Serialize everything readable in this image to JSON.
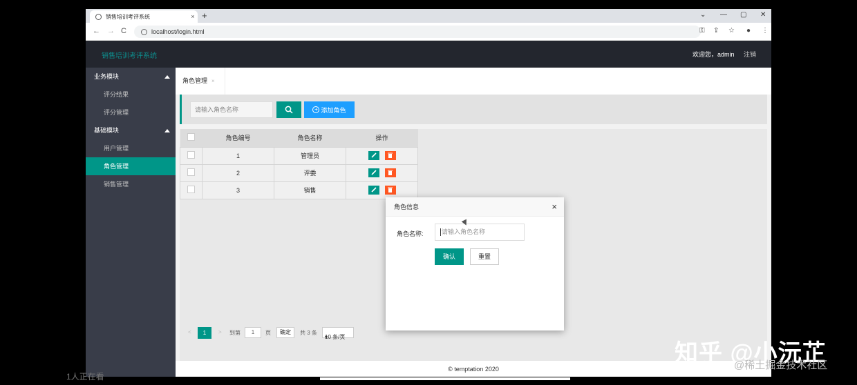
{
  "browser": {
    "tab_title": "销售培训考评系统",
    "tab_close": "×",
    "new_tab": "+",
    "url": "localhost/login.html",
    "controls": [
      "⌄",
      "—",
      "▢",
      "✕"
    ],
    "nav": [
      "←",
      "→",
      "C"
    ]
  },
  "header": {
    "title": "销售培训考评系统",
    "welcome": "欢迎您，admin",
    "logout": "注销"
  },
  "sidebar": {
    "groups": [
      {
        "label": "业务模块",
        "items": [
          "评分结果",
          "评分管理"
        ]
      },
      {
        "label": "基础模块",
        "items": [
          "用户管理",
          "角色管理",
          "销售管理"
        ]
      }
    ]
  },
  "page_tab": {
    "label": "角色管理",
    "close": "×"
  },
  "search": {
    "placeholder": "请输入角色名称",
    "add_label": "添加角色",
    "add_icon": "+"
  },
  "table": {
    "columns": [
      "角色编号",
      "角色名称",
      "操作"
    ],
    "rows": [
      {
        "id": "1",
        "name": "管理员"
      },
      {
        "id": "2",
        "name": "评委"
      },
      {
        "id": "3",
        "name": "销售"
      }
    ]
  },
  "pager": {
    "prev": "<",
    "current": "1",
    "next": ">",
    "goto_label": "到第",
    "goto_value": "1",
    "page_unit": "页",
    "confirm": "确定",
    "total": "共 3 条",
    "page_size": "10 条/页"
  },
  "footer": {
    "text": "© temptation 2020"
  },
  "modal": {
    "title": "角色信息",
    "close": "×",
    "field_label": "角色名称:",
    "field_placeholder": "请输入角色名称",
    "confirm": "确认",
    "reset": "重置"
  },
  "overlay": {
    "viewers": "1人正在看",
    "watermark": "知乎 @小沅芷",
    "watermark2": "@稀土掘金技术社区"
  },
  "colors": {
    "accent": "#009688",
    "blue": "#1e9fff",
    "danger": "#ff5722",
    "sidebar": "#393d49",
    "header": "#23262e"
  }
}
